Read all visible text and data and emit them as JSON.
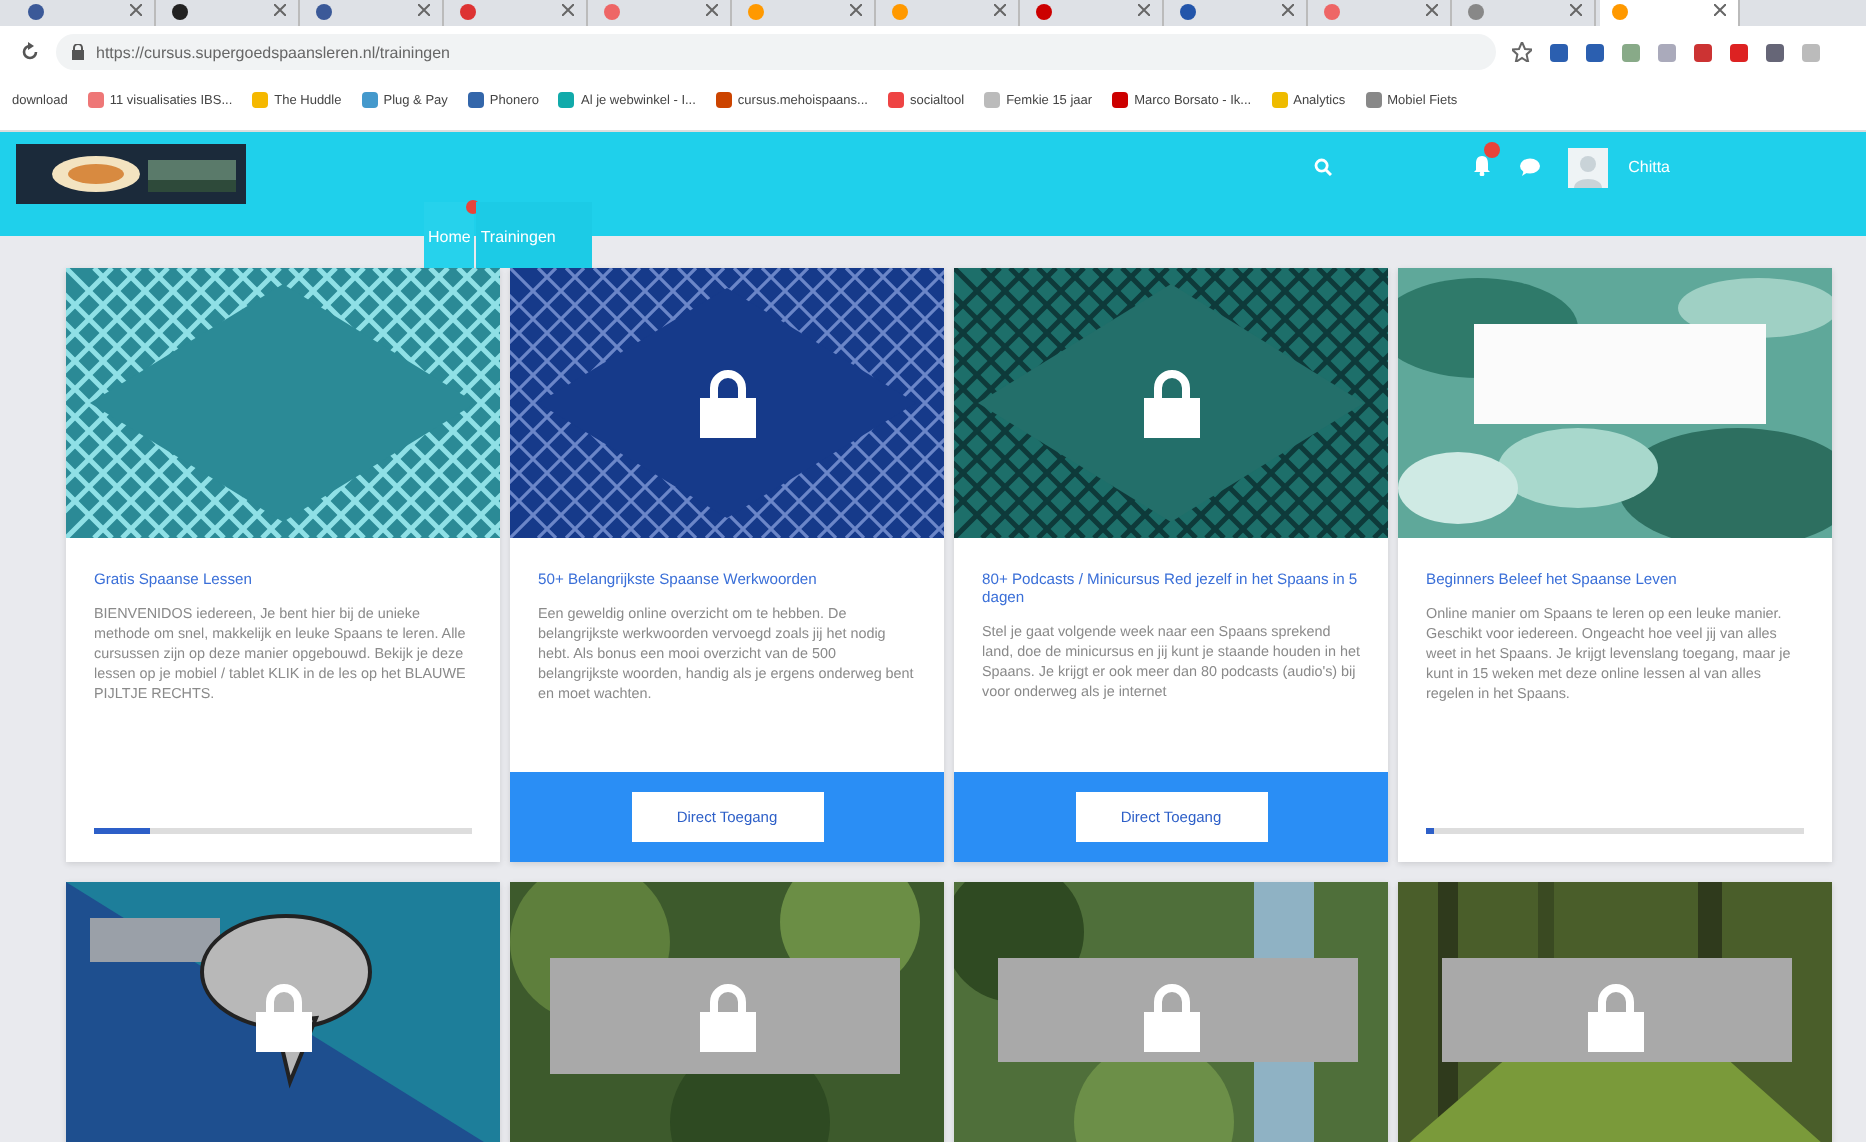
{
  "browser": {
    "tabs": [
      {
        "selected": false
      },
      {
        "selected": false
      },
      {
        "selected": false
      },
      {
        "selected": false
      },
      {
        "selected": false
      },
      {
        "selected": false
      },
      {
        "selected": false
      },
      {
        "selected": false
      },
      {
        "selected": false
      },
      {
        "selected": false
      },
      {
        "selected": false
      },
      {
        "selected": true
      }
    ],
    "url": "https://cursus.supergoedspaansleren.nl/trainingen",
    "bookmarks": [
      "download",
      "11 visualisaties IBS...",
      "The Huddle",
      "Plug & Pay",
      "Phonero",
      "Al je webwinkel - I...",
      "cursus.mehoispaans...",
      "socialtool",
      "Femkie 15 jaar",
      "Marco Borsato - Ik...",
      "Analytics",
      "Mobiel Fiets"
    ]
  },
  "header": {
    "user": "Chitta",
    "nav": [
      {
        "label": "Home",
        "selected": false,
        "badge": true
      },
      {
        "label": "Trainingen",
        "selected": true,
        "badge": false
      }
    ]
  },
  "cards": [
    {
      "locked": false,
      "title": "Gratis Spaanse Lessen",
      "text": "BIENVENIDOS iedereen, Je bent hier bij de unieke methode om snel, makkelijk en leuke Spaans te leren. Alle cursussen zijn op deze manier opgebouwd. Bekijk je deze lessen op je mobiel / tablet KLIK in de les op het BLAUWE PIJLTJE RECHTS.",
      "progress": {
        "level": 0.15
      }
    },
    {
      "locked": true,
      "title": "50+ Belangrijkste Spaanse Werkwoorden",
      "text": "Een geweldig online overzicht om te hebben. De belangrijkste werkwoorden vervoegd zoals jij het nodig hebt. Als bonus een mooi overzicht van de 500 belangrijkste woorden, handig als je ergens onderweg bent en moet wachten.",
      "button": "Direct Toegang"
    },
    {
      "locked": true,
      "title": "80+ Podcasts / Minicursus Red jezelf in het Spaans in 5 dagen",
      "text": "Stel je gaat volgende week naar een Spaans sprekend land, doe de minicursus en jij kunt je staande houden in het Spaans. Je krijgt er ook meer dan 80 podcasts (audio's) bij voor onderweg als je internet",
      "button": "Direct Toegang"
    },
    {
      "locked": false,
      "title": "Beginners Beleef het Spaanse Leven",
      "text": "Online manier om Spaans te leren op een leuke manier. Geschikt voor iedereen. Ongeacht hoe veel jij van alles weet in het Spaans. Je krijgt levenslang toegang, maar je kunt in 15 weken met deze online lessen al van alles regelen in het Spaans.",
      "progress": {
        "level": 0.02
      }
    },
    {
      "locked": true
    },
    {
      "locked": true
    },
    {
      "locked": true
    },
    {
      "locked": true
    }
  ]
}
